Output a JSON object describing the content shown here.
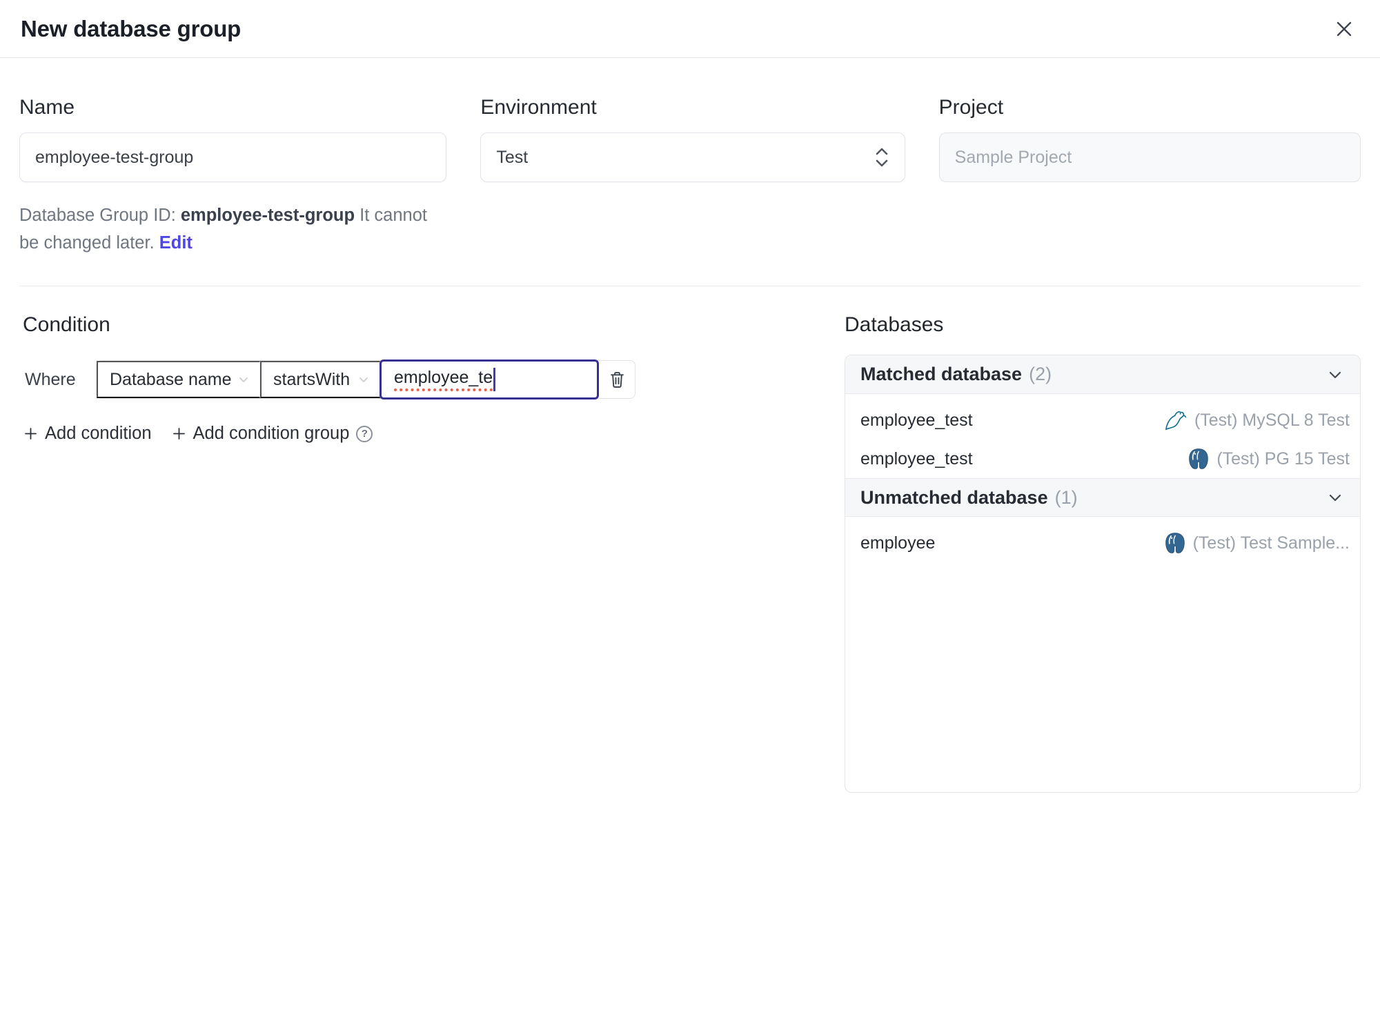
{
  "header": {
    "title": "New database group"
  },
  "form": {
    "name": {
      "label": "Name",
      "value": "employee-test-group"
    },
    "environment": {
      "label": "Environment",
      "value": "Test"
    },
    "project": {
      "label": "Project",
      "value": "Sample Project"
    },
    "group_id_note": {
      "prefix": "Database Group ID: ",
      "id": "employee-test-group",
      "suffix": " It cannot be changed later. ",
      "edit_label": "Edit"
    }
  },
  "condition": {
    "heading": "Condition",
    "where_label": "Where",
    "factor": "Database name",
    "operator": "startsWith",
    "value": "employee_te",
    "add_condition_label": "Add condition",
    "add_condition_group_label": "Add condition group",
    "help_glyph": "?"
  },
  "databases": {
    "heading": "Databases",
    "sections": [
      {
        "title": "Matched database",
        "count": "(2)",
        "rows": [
          {
            "name": "employee_test",
            "engine": "mysql",
            "instance": "(Test) MySQL 8 Test"
          },
          {
            "name": "employee_test",
            "engine": "postgresql",
            "instance": "(Test) PG 15 Test"
          }
        ]
      },
      {
        "title": "Unmatched database",
        "count": "(1)",
        "rows": [
          {
            "name": "employee",
            "engine": "postgresql",
            "instance": "(Test) Test Sample..."
          }
        ]
      }
    ]
  },
  "colors": {
    "accent": "#4f46e5",
    "focus_border": "#373091",
    "spell": "#e8604f",
    "mysql": "#11708f",
    "pg": "#336791",
    "muted": "#9aa1ab",
    "header_bg": "#f6f7f8"
  }
}
